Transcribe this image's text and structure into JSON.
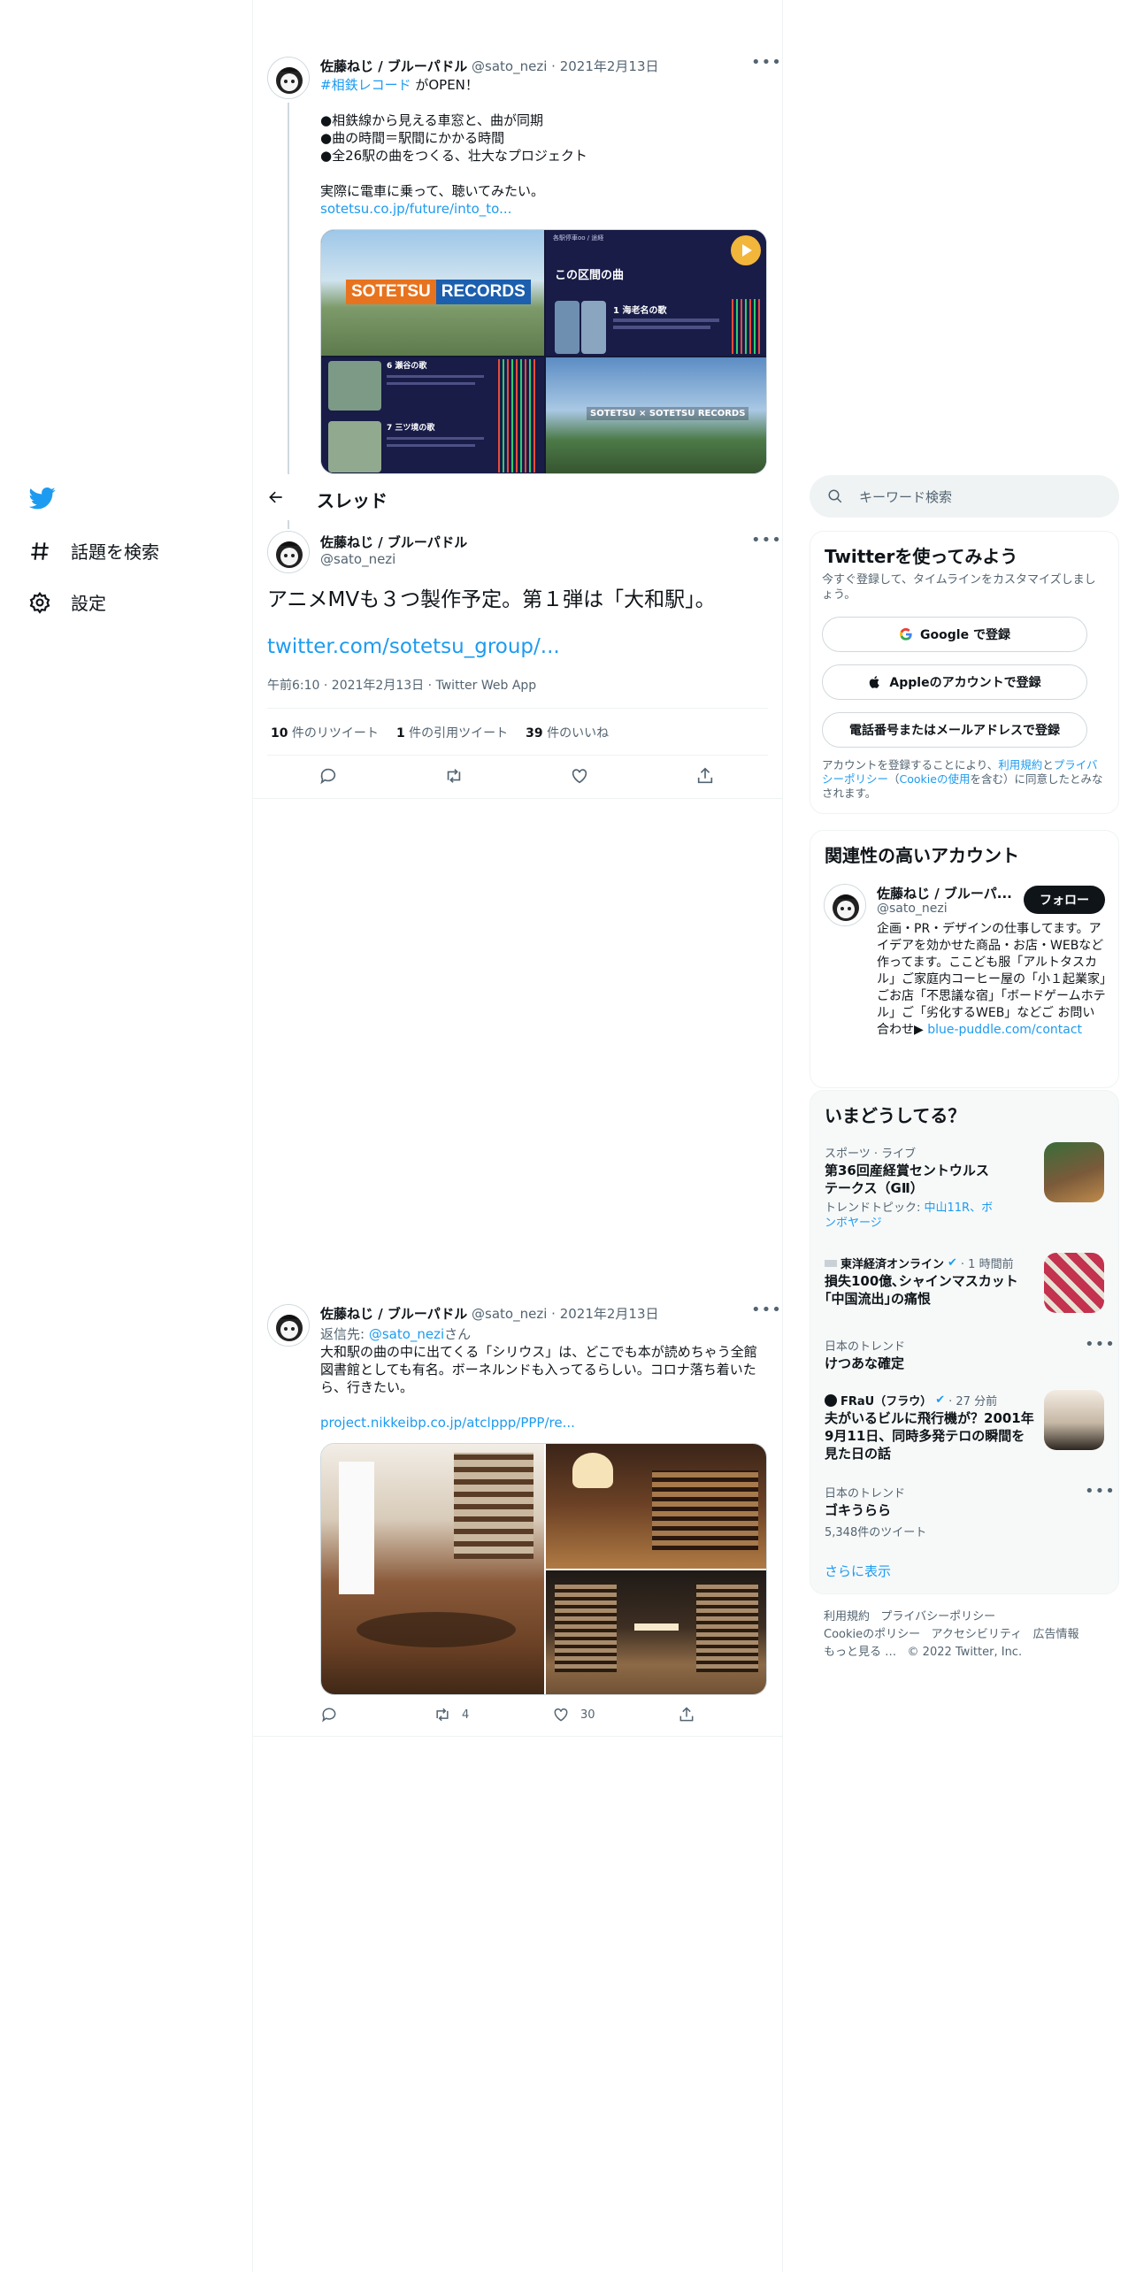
{
  "nav": {
    "explore_label": "話題を検索",
    "settings_label": "設定"
  },
  "header": {
    "title": "スレッド"
  },
  "tweet1": {
    "author_name": "佐藤ねじ / ブルーパドル",
    "handle": "@sato_nezi",
    "date": "2021年2月13日",
    "hashtag": "#相鉄レコード",
    "text_after_hashtag": " がOPEN！",
    "body": "●相鉄線から見える車窓と、曲が同期\n●曲の時間＝駅間にかかる時間\n●全26駅の曲をつくる、壮大なプロジェクト\n\n実際に電車に乗って、聴いてみたい。",
    "link": "sotetsu.co.jp/future/into_to...",
    "media": {
      "logo_text_1": "SOTETSU",
      "logo_text_2": "RECORDS",
      "panel_title": "この区間の曲",
      "panel_header": "各駅停車oo / 途経",
      "song1": "1 海老名の歌",
      "song6": "6 瀬谷の歌",
      "song7": "7 三ツ境の歌",
      "badge": "SOTETSU × SOTETSU RECORDS"
    }
  },
  "main_tweet": {
    "author_name": "佐藤ねじ / ブルーパドル",
    "handle": "@sato_nezi",
    "text": "アニメMVも３つ製作予定。第１弾は「大和駅」。",
    "link": "twitter.com/sotetsu_group/...",
    "meta": "午前6:10 · 2021年2月13日 · Twitter Web App",
    "stats": {
      "retweets_count": "10",
      "retweets_label": " 件のリツイート",
      "quotes_count": "1",
      "quotes_label": " 件の引用ツイート",
      "likes_count": "39",
      "likes_label": " 件のいいね"
    }
  },
  "tweet3": {
    "author_name": "佐藤ねじ / ブルーパドル",
    "handle": "@sato_nezi",
    "date": "2021年2月13日",
    "reply_prefix": "返信先: ",
    "reply_handle": "@sato_nezi",
    "reply_suffix": "さん",
    "body": "大和駅の曲の中に出てくる「シリウス」は、どこでも本が読めちゃう全館図書館としても有名。ボーネルンドも入ってるらしい。コロナ落ち着いたら、行きたい。",
    "link": "project.nikkeibp.co.jp/atclppp/PPP/re...",
    "retweets": "4",
    "likes": "30"
  },
  "search": {
    "placeholder": "キーワード検索"
  },
  "signup": {
    "title": "Twitterを使ってみよう",
    "subtitle": "今すぐ登録して、タイムラインをカスタマイズしましょう。",
    "google_button": "Google で登録",
    "apple_button": "Appleのアカウントで登録",
    "phone_button": "電話番号またはメールアドレスで登録",
    "legal_prefix": "アカウントを登録することにより、",
    "legal_terms": "利用規約",
    "legal_and": "と",
    "legal_privacy": "プライバシーポリシー",
    "legal_open": "（",
    "legal_cookie": "Cookieの使用",
    "legal_suffix": "を含む）に同意したとみなされます。"
  },
  "related": {
    "title": "関連性の高いアカウント",
    "name": "佐藤ねじ / ブルーパ...",
    "handle": "@sato_nezi",
    "follow_button": "フォロー",
    "bio": "企画・PR・デザインの仕事してます。アイデアを効かせた商品・お店・WEBなど作ってます。ここども服「アルトタスカル」ご家庭内コーヒー屋の「小１起業家」ごお店「不思議な宿」「ボードゲームホテル」ご「劣化するWEB」などご お問い合わせ▶ ",
    "bio_link": "blue-puddle.com/contact"
  },
  "trends": {
    "title": "いまどうしてる？",
    "items": [
      {
        "category": "スポーツ · ライブ",
        "title": "第36回産経賞セントウルステークス（GⅡ）",
        "topic_prefix": "トレンドトピック: ",
        "topic_links": "中山11R、ボンボヤージ"
      },
      {
        "source": "東洋経済オンライン",
        "time": "· 1 時間前",
        "title": "損失100億､シャインマスカット｢中国流出｣の痛恨"
      },
      {
        "category": "日本のトレンド",
        "title": "けつあな確定"
      },
      {
        "source": "FRaU（フラウ）",
        "time": "· 27 分前",
        "title": "夫がいるビルに飛行機が？2001年9月11日、同時多発テロの瞬間を見た日の話"
      },
      {
        "category": "日本のトレンド",
        "title": "ゴキうらら",
        "count": "5,348件のツイート"
      }
    ],
    "show_more": "さらに表示"
  },
  "footer": {
    "line1_a": "利用規約",
    "line1_b": "プライバシーポリシー",
    "line2_a": "Cookieのポリシー",
    "line2_b": "アクセシビリティ",
    "line2_c": "広告情報",
    "line3_a": "もっと見る …",
    "line3_b": "© 2022 Twitter, Inc."
  },
  "colors": {
    "accent": "#1d9bf0",
    "text": "#0f1419",
    "muted": "#536471",
    "sidebar_bg": "#f7f9f9",
    "border": "#eff3f4"
  }
}
